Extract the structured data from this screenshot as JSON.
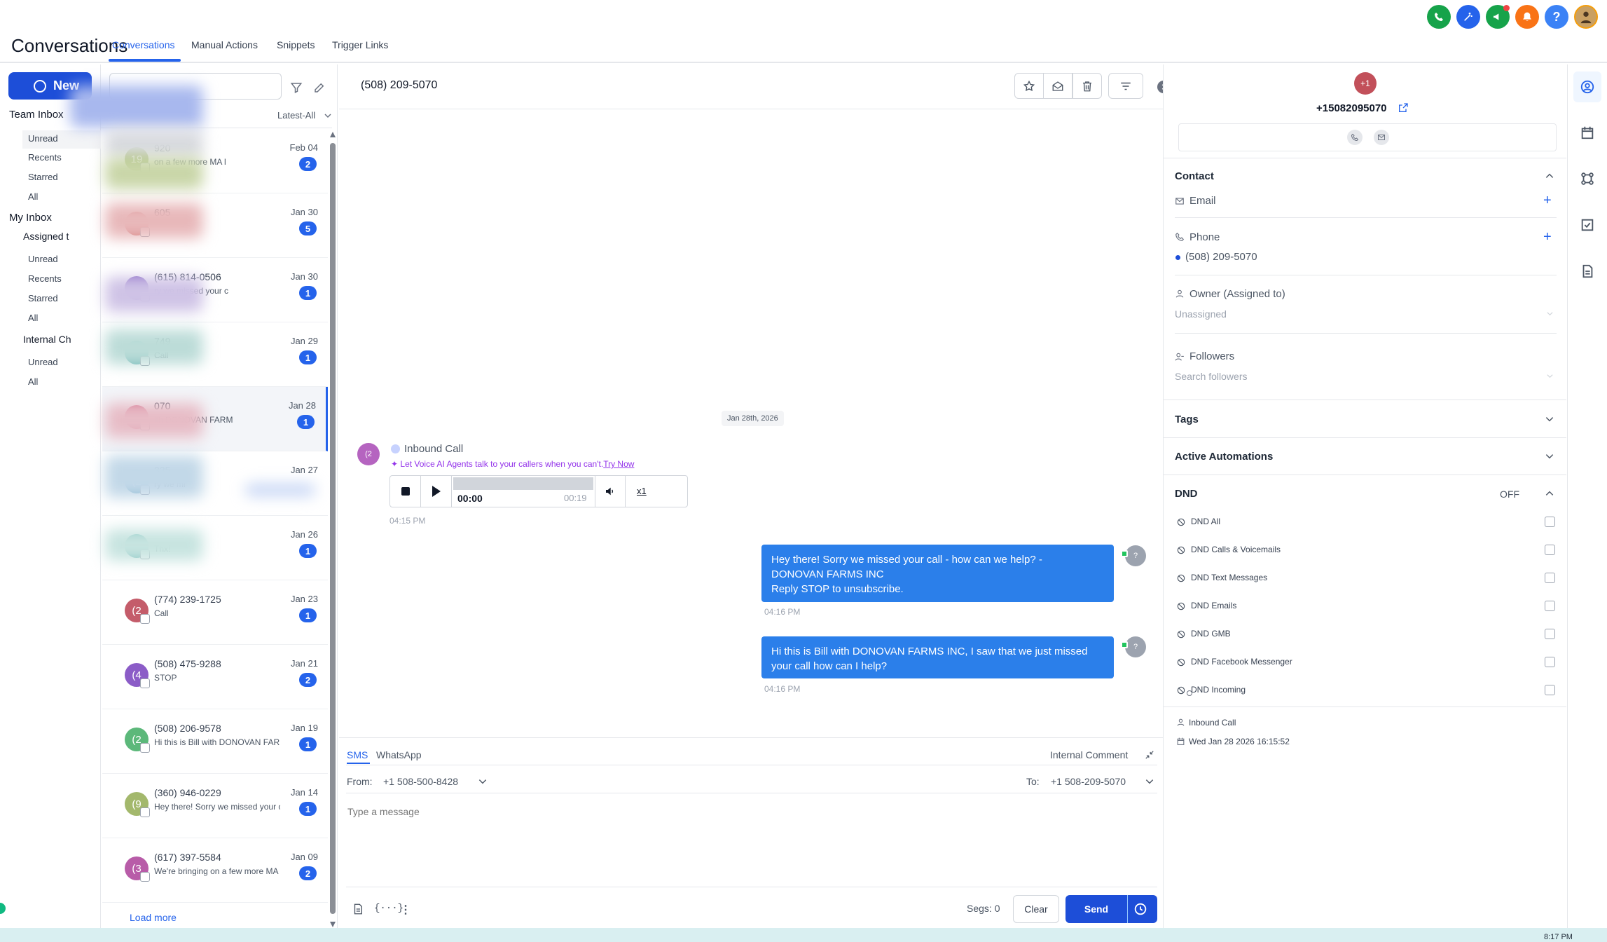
{
  "header": {
    "app_title": "Conversations",
    "tabs": [
      {
        "label": "Conversations",
        "active": true
      },
      {
        "label": "Manual Actions"
      },
      {
        "label": "Snippets"
      },
      {
        "label": "Trigger Links"
      }
    ],
    "top_icons": [
      "phone-icon",
      "magic-wand-icon",
      "megaphone-icon",
      "bell-icon",
      "help-icon",
      "user-avatar"
    ],
    "help_label": "?"
  },
  "left_nav": {
    "new_label": "New",
    "team_inbox": "Team Inbox",
    "team_items": [
      "Unread",
      "Recents",
      "Starred",
      "All"
    ],
    "my_inbox": "My Inbox",
    "assigned": "Assigned t",
    "my_items": [
      "Unread",
      "Recents",
      "Starred",
      "All"
    ],
    "internal": "Internal Ch",
    "internal_items": [
      "Unread",
      "All"
    ]
  },
  "list": {
    "sort_label": "Latest-All",
    "load_more": "Load more",
    "conversations": [
      {
        "name": "920",
        "initials": "19",
        "preview": "on a few more MA l",
        "date": "Feb 04",
        "count": "2",
        "color": "#a3b86c"
      },
      {
        "name": "605",
        "initials": "",
        "preview": "",
        "date": "Jan 30",
        "count": "5",
        "color": "#d46a6a"
      },
      {
        "name": "(615) 814-0506",
        "initials": "",
        "preview": "ry we missed your c",
        "date": "Jan 30",
        "count": "1",
        "color": "#8b6cc7"
      },
      {
        "name": "749",
        "initials": "",
        "preview": "Call",
        "date": "Jan 29",
        "count": "1",
        "color": "#6cb8b8"
      },
      {
        "name": "070",
        "initials": "",
        "preview": "ith DONOVAN FARM",
        "date": "Jan 28",
        "count": "1",
        "color": "#d46a8a"
      },
      {
        "name": "335",
        "initials": "(2",
        "preview": "ry we mi",
        "date": "Jan 27",
        "count": "",
        "color": "#6ca8c8"
      },
      {
        "name": "",
        "initials": "",
        "preview": "Thx!",
        "date": "Jan 26",
        "count": "1",
        "color": "#6cb8b8"
      },
      {
        "name": "(774) 239-1725",
        "initials": "(2",
        "preview": "Call",
        "date": "Jan 23",
        "count": "1",
        "color": "#c45c6a"
      },
      {
        "name": "(508) 475-9288",
        "initials": "(4",
        "preview": "STOP",
        "date": "Jan 21",
        "count": "2",
        "color": "#8b5cc7"
      },
      {
        "name": "(508) 206-9578",
        "initials": "(2",
        "preview": "Hi this is Bill with DONOVAN FARM",
        "date": "Jan 19",
        "count": "1",
        "color": "#5cb87a"
      },
      {
        "name": "(360) 946-0229",
        "initials": "(9",
        "preview": "Hey there! Sorry we missed your c",
        "date": "Jan 14",
        "count": "1",
        "color": "#a3b86c"
      },
      {
        "name": "(617) 397-5584",
        "initials": "(3",
        "preview": "We're bringing on a few more MA l",
        "date": "Jan 09",
        "count": "2",
        "color": "#b85ca8"
      }
    ]
  },
  "chat": {
    "title": "(508) 209-5070",
    "date_chip": "Jan 28th, 2026",
    "inbound_avatar": "(2",
    "inbound_label": "Inbound Call",
    "voice_promo": "Let Voice AI Agents talk to your callers when you can't.",
    "try_now": "Try Now",
    "audio_current": "00:00",
    "audio_total": "00:19",
    "audio_speed": "x1",
    "inbound_time": "04:15 PM",
    "messages": [
      {
        "text": "Hey there! Sorry we missed your call - how can we help? -\n DONOVAN FARMS INC\nReply STOP to unsubscribe.",
        "time": "04:16 PM"
      },
      {
        "text": "Hi this is Bill with DONOVAN FARMS INC, I saw that we just missed your call how can I help?",
        "time": "04:16 PM"
      }
    ],
    "out_avatar": "?"
  },
  "composer": {
    "tabs": [
      "SMS",
      "WhatsApp"
    ],
    "internal_comment": "Internal Comment",
    "from_label": "From:",
    "from_value": "+1 508-500-8428",
    "to_label": "To:",
    "to_value": "+1 508-209-5070",
    "placeholder": "Type a message",
    "segs": "Segs: 0",
    "clear": "Clear",
    "send": "Send"
  },
  "contact": {
    "avatar": "+1",
    "phone_title": "+15082095070",
    "contact_header": "Contact",
    "email_label": "Email",
    "phone_label": "Phone",
    "phone_value": "(508) 209-5070",
    "owner_label": "Owner (Assigned to)",
    "owner_value": "Unassigned",
    "followers_label": "Followers",
    "followers_placeholder": "Search followers",
    "tags_header": "Tags",
    "automations_header": "Active Automations",
    "dnd_header": "DND",
    "dnd_status": "OFF",
    "dnd_items": [
      "DND All",
      "DND Calls & Voicemails",
      "DND Text Messages",
      "DND Emails",
      "DND GMB",
      "DND Facebook Messenger",
      "DND Incoming"
    ],
    "source": "Inbound Call",
    "created": "Wed Jan 28 2026 16:15:52"
  },
  "colors": {
    "accent": "#2563eb",
    "bubble": "#2b7fea",
    "avatar_contact": "#c2505a",
    "inbound_avatar": "#b564c0"
  },
  "taskbar_time": "8:17 PM"
}
